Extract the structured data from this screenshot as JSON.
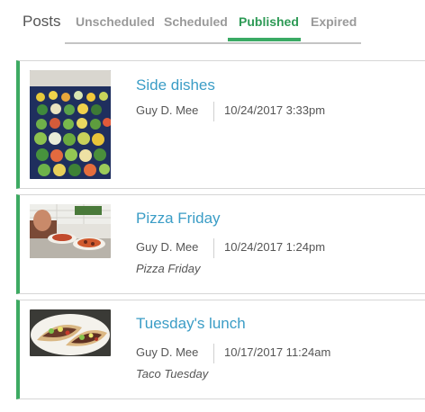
{
  "header": {
    "title": "Posts",
    "tabs": [
      {
        "label": "Unscheduled",
        "active": false
      },
      {
        "label": "Scheduled",
        "active": false
      },
      {
        "label": "Published",
        "active": true
      },
      {
        "label": "Expired",
        "active": false
      }
    ]
  },
  "colors": {
    "accent_green": "#3daa62",
    "title_blue": "#3b9dc6",
    "text_gray": "#555555",
    "tab_inactive": "#9a9a9a"
  },
  "posts": [
    {
      "title": "Side dishes",
      "author": "Guy D. Mee",
      "date": "10/24/2017 3:33pm",
      "summary": "",
      "thumbnail": "food-tray-photo"
    },
    {
      "title": "Pizza Friday",
      "author": "Guy D. Mee",
      "date": "10/24/2017 1:24pm",
      "summary": "Pizza Friday",
      "thumbnail": "pizza-serving-photo"
    },
    {
      "title": "Tuesday's lunch",
      "author": "Guy D. Mee",
      "date": "10/17/2017 11:24am",
      "summary": "Taco Tuesday",
      "thumbnail": "tacos-plate-photo"
    }
  ]
}
